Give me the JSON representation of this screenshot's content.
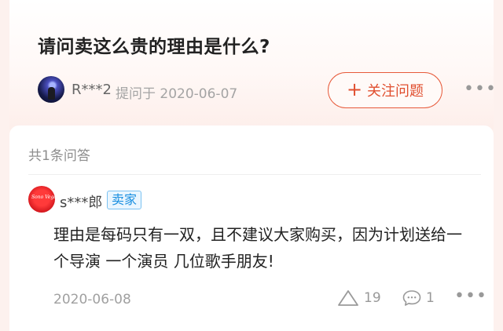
{
  "question": {
    "title": "请问卖这么贵的理由是什么?",
    "asker_name": "R***2",
    "asked_meta": "提问于 2020-06-07",
    "follow_label": "关注问题",
    "follow_icon": "plus-icon",
    "more_label": "•••"
  },
  "answers": {
    "count_label": "共1条问答",
    "items": [
      {
        "user": "s***郎",
        "badge": "卖家",
        "avatar_text": "Sono Vega",
        "text": "理由是每码只有一双，且不建议大家购买，因为计划送给一个导演 一个演员 几位歌手朋友!",
        "date": "2020-06-08",
        "likes": "19",
        "comments": "1",
        "more_label": "•••"
      }
    ]
  },
  "colors": {
    "accent": "#e75a3a",
    "badge_blue": "#1a8fe0",
    "muted": "#a0a0a0"
  }
}
